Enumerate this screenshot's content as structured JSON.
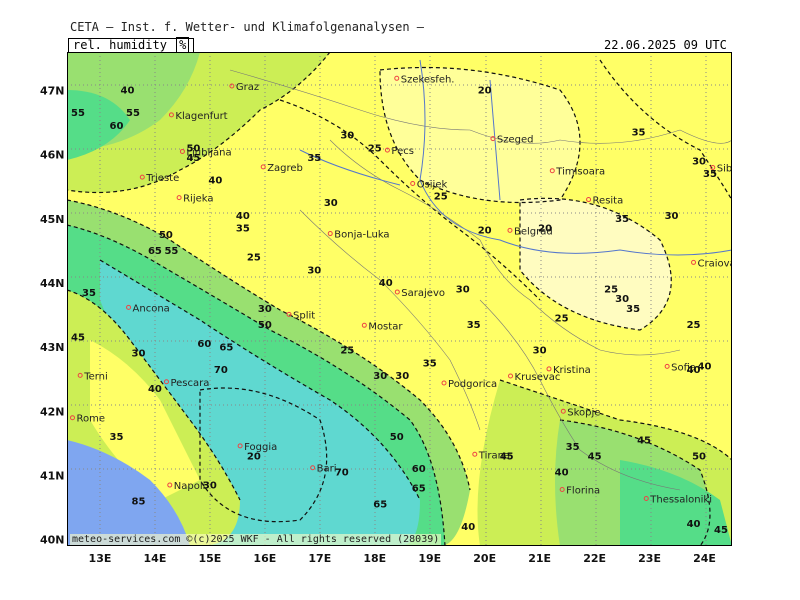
{
  "header": {
    "title": "CETA — Inst. f. Wetter- und Klimafolgenanalysen —",
    "parameter": "rel. humidity",
    "unit": "%",
    "datetime": "22.06.2025 09 UTC"
  },
  "footer": {
    "credit": "meteo-services.com ©(c)2025 WKF - All rights reserved (28039)"
  },
  "colors": {
    "water_blue": "#7fa6f0",
    "sea_cyan": "#5fd8d0",
    "green": "#55dd88",
    "light_green": "#99e070",
    "yellow_green": "#ccee55",
    "yellow": "#ffff66",
    "pale_yellow": "#ffff99",
    "cream": "#fffcc0",
    "city_marker": "#ee4444",
    "grid": "#888888"
  },
  "axes": {
    "lat_labels": [
      "47N",
      "46N",
      "45N",
      "44N",
      "43N",
      "42N",
      "41N",
      "40N"
    ],
    "lon_labels": [
      "13E",
      "14E",
      "15E",
      "16E",
      "17E",
      "18E",
      "19E",
      "20E",
      "21E",
      "22E",
      "23E",
      "24E"
    ]
  },
  "cities": [
    {
      "name": "Graz",
      "lon": 15.4,
      "lat": 47.07
    },
    {
      "name": "Szekesfeh.",
      "lon": 18.4,
      "lat": 47.19
    },
    {
      "name": "Klagenfurt",
      "lon": 14.3,
      "lat": 46.62
    },
    {
      "name": "Ljubljana",
      "lon": 14.5,
      "lat": 46.05
    },
    {
      "name": "Zagreb",
      "lon": 15.97,
      "lat": 45.81
    },
    {
      "name": "Pecs",
      "lon": 18.23,
      "lat": 46.07
    },
    {
      "name": "Szeged",
      "lon": 20.15,
      "lat": 46.25
    },
    {
      "name": "Timisoara",
      "lon": 21.23,
      "lat": 45.75
    },
    {
      "name": "Trieste",
      "lon": 13.77,
      "lat": 45.65
    },
    {
      "name": "Rijeka",
      "lon": 14.44,
      "lat": 45.33
    },
    {
      "name": "Osijek",
      "lon": 18.69,
      "lat": 45.55
    },
    {
      "name": "Resita",
      "lon": 21.89,
      "lat": 45.3
    },
    {
      "name": "Sibiu",
      "lon": 24.15,
      "lat": 45.8
    },
    {
      "name": "Bonja-Luka",
      "lon": 17.19,
      "lat": 44.77
    },
    {
      "name": "Belgrad",
      "lon": 20.46,
      "lat": 44.82
    },
    {
      "name": "Craiova",
      "lon": 23.8,
      "lat": 44.32
    },
    {
      "name": "Sarajevo",
      "lon": 18.41,
      "lat": 43.86
    },
    {
      "name": "Split",
      "lon": 16.44,
      "lat": 43.51
    },
    {
      "name": "Ancona",
      "lon": 13.52,
      "lat": 43.62
    },
    {
      "name": "Mostar",
      "lon": 17.81,
      "lat": 43.34
    },
    {
      "name": "Kristina",
      "lon": 21.17,
      "lat": 42.66
    },
    {
      "name": "Sofia",
      "lon": 23.32,
      "lat": 42.7
    },
    {
      "name": "Terni",
      "lon": 12.64,
      "lat": 42.56
    },
    {
      "name": "Pescara",
      "lon": 14.21,
      "lat": 42.46
    },
    {
      "name": "Podgorica",
      "lon": 19.26,
      "lat": 42.44
    },
    {
      "name": "Krusevac",
      "lon": 20.47,
      "lat": 42.55
    },
    {
      "name": "Skopje",
      "lon": 21.43,
      "lat": 42.0
    },
    {
      "name": "Rome",
      "lon": 12.5,
      "lat": 41.9
    },
    {
      "name": "Foggia",
      "lon": 15.55,
      "lat": 41.46
    },
    {
      "name": "Tirana",
      "lon": 19.82,
      "lat": 41.33
    },
    {
      "name": "Bari",
      "lon": 16.87,
      "lat": 41.12
    },
    {
      "name": "Napoli",
      "lon": 14.27,
      "lat": 40.85
    },
    {
      "name": "Florina",
      "lon": 21.41,
      "lat": 40.78
    },
    {
      "name": "Thessaloniki",
      "lon": 22.94,
      "lat": 40.64
    }
  ],
  "contour_labels": [
    {
      "text": "20",
      "lon": 20.0,
      "lat": 46.95
    },
    {
      "text": "30",
      "lon": 17.5,
      "lat": 46.25
    },
    {
      "text": "25",
      "lon": 18.0,
      "lat": 46.05
    },
    {
      "text": "35",
      "lon": 16.9,
      "lat": 45.9
    },
    {
      "text": "35",
      "lon": 22.8,
      "lat": 46.3
    },
    {
      "text": "30",
      "lon": 23.9,
      "lat": 45.85
    },
    {
      "text": "35",
      "lon": 24.1,
      "lat": 45.65
    },
    {
      "text": "40",
      "lon": 15.1,
      "lat": 45.55
    },
    {
      "text": "30",
      "lon": 17.2,
      "lat": 45.2
    },
    {
      "text": "25",
      "lon": 19.2,
      "lat": 45.3
    },
    {
      "text": "35",
      "lon": 22.5,
      "lat": 44.95
    },
    {
      "text": "30",
      "lon": 23.4,
      "lat": 45.0
    },
    {
      "text": "40",
      "lon": 15.6,
      "lat": 45.0
    },
    {
      "text": "35",
      "lon": 15.6,
      "lat": 44.8
    },
    {
      "text": "20",
      "lon": 20.0,
      "lat": 44.77
    },
    {
      "text": "20",
      "lon": 21.1,
      "lat": 44.8
    },
    {
      "text": "25",
      "lon": 15.8,
      "lat": 44.35
    },
    {
      "text": "30",
      "lon": 16.9,
      "lat": 44.15
    },
    {
      "text": "40",
      "lon": 18.2,
      "lat": 43.95
    },
    {
      "text": "30",
      "lon": 19.6,
      "lat": 43.85
    },
    {
      "text": "25",
      "lon": 22.3,
      "lat": 43.85
    },
    {
      "text": "30",
      "lon": 22.5,
      "lat": 43.7
    },
    {
      "text": "35",
      "lon": 22.7,
      "lat": 43.55
    },
    {
      "text": "25",
      "lon": 21.4,
      "lat": 43.4
    },
    {
      "text": "25",
      "lon": 23.8,
      "lat": 43.3
    },
    {
      "text": "30",
      "lon": 16.0,
      "lat": 43.55
    },
    {
      "text": "50",
      "lon": 16.0,
      "lat": 43.3
    },
    {
      "text": "35",
      "lon": 19.8,
      "lat": 43.3
    },
    {
      "text": "60",
      "lon": 14.9,
      "lat": 43.0
    },
    {
      "text": "65",
      "lon": 15.3,
      "lat": 42.95
    },
    {
      "text": "25",
      "lon": 17.5,
      "lat": 42.9
    },
    {
      "text": "30",
      "lon": 21.0,
      "lat": 42.9
    },
    {
      "text": "35",
      "lon": 19.0,
      "lat": 42.7
    },
    {
      "text": "40",
      "lon": 24.0,
      "lat": 42.65
    },
    {
      "text": "45",
      "lon": 12.6,
      "lat": 43.1
    },
    {
      "text": "30",
      "lon": 13.7,
      "lat": 42.85
    },
    {
      "text": "40",
      "lon": 14.0,
      "lat": 42.3
    },
    {
      "text": "70",
      "lon": 15.2,
      "lat": 42.6
    },
    {
      "text": "30",
      "lon": 18.1,
      "lat": 42.5
    },
    {
      "text": "30",
      "lon": 18.5,
      "lat": 42.5
    },
    {
      "text": "35",
      "lon": 13.3,
      "lat": 41.55
    },
    {
      "text": "50",
      "lon": 18.4,
      "lat": 41.55
    },
    {
      "text": "60",
      "lon": 18.8,
      "lat": 41.05
    },
    {
      "text": "70",
      "lon": 17.4,
      "lat": 41.0
    },
    {
      "text": "65",
      "lon": 18.8,
      "lat": 40.75
    },
    {
      "text": "65",
      "lon": 18.1,
      "lat": 40.5
    },
    {
      "text": "45",
      "lon": 20.4,
      "lat": 41.25
    },
    {
      "text": "40",
      "lon": 21.4,
      "lat": 41.0
    },
    {
      "text": "45",
      "lon": 22.0,
      "lat": 41.25
    },
    {
      "text": "45",
      "lon": 22.9,
      "lat": 41.5
    },
    {
      "text": "50",
      "lon": 23.9,
      "lat": 41.25
    },
    {
      "text": "35",
      "lon": 21.6,
      "lat": 41.4
    },
    {
      "text": "30",
      "lon": 15.0,
      "lat": 40.8
    },
    {
      "text": "20",
      "lon": 15.8,
      "lat": 41.25
    },
    {
      "text": "85",
      "lon": 13.7,
      "lat": 40.55
    },
    {
      "text": "40",
      "lon": 19.7,
      "lat": 40.15
    },
    {
      "text": "40",
      "lon": 23.8,
      "lat": 40.2
    },
    {
      "text": "45",
      "lon": 24.3,
      "lat": 40.1
    },
    {
      "text": "55",
      "lon": 13.6,
      "lat": 46.6
    },
    {
      "text": "55",
      "lon": 12.6,
      "lat": 46.6
    },
    {
      "text": "60",
      "lon": 13.3,
      "lat": 46.4
    },
    {
      "text": "40",
      "lon": 13.5,
      "lat": 46.95
    },
    {
      "text": "50",
      "lon": 14.7,
      "lat": 46.05
    },
    {
      "text": "45",
      "lon": 14.7,
      "lat": 45.9
    },
    {
      "text": "50",
      "lon": 14.2,
      "lat": 44.7
    },
    {
      "text": "55",
      "lon": 14.3,
      "lat": 44.45
    },
    {
      "text": "65",
      "lon": 14.0,
      "lat": 44.45
    },
    {
      "text": "35",
      "lon": 12.8,
      "lat": 43.8
    },
    {
      "text": "40",
      "lon": 23.8,
      "lat": 42.6
    }
  ]
}
